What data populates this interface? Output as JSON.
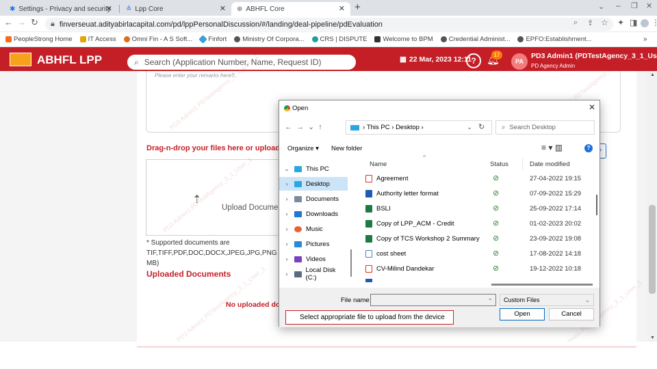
{
  "browser": {
    "tabs": [
      {
        "label": "Settings - Privacy and security",
        "active": false
      },
      {
        "label": "Lpp Core",
        "active": false
      },
      {
        "label": "ABHFL Core",
        "active": true
      }
    ],
    "new_tab": "+",
    "url": "finverseuat.adityabirlacapital.com/pd/lppPersonalDiscussion/#/landing/deal-pipeline/pdEvaluation",
    "bookmarks": [
      {
        "label": "PeopleStrong Home",
        "color": "#f36b21"
      },
      {
        "label": "IT Access",
        "color": "#e5a50a"
      },
      {
        "label": "Omni Fin - A S Soft...",
        "color": "#e06b1c"
      },
      {
        "label": "Finfort",
        "color": "#3aa0d8"
      },
      {
        "label": "Ministry Of Corpora...",
        "color": "#555555"
      },
      {
        "label": "CRS | DISPUTE",
        "color": "#1aa29b"
      },
      {
        "label": "Welcome to BPM",
        "color": "#333333"
      },
      {
        "label": "Credential Administ...",
        "color": "#555555"
      },
      {
        "label": "EPFO:Establishment...",
        "color": "#555555"
      }
    ],
    "more_bookmarks": "»"
  },
  "app": {
    "title": "ABHFL LPP",
    "search_placeholder": "Search (Application Number, Name, Request ID)",
    "date": "22 Mar, 2023 12:11",
    "notification_count": "17",
    "avatar_initials": "PA",
    "user_name": "PD3 Admin1 (PDTestAgency_3_1_User_",
    "user_role": "PD Agency Admin",
    "brand_color": "#c41f27"
  },
  "page": {
    "remarks_placeholder": "Please enter your remarks here?.",
    "drag_text": "Drag-n-drop your files here or upload by",
    "upload_label": "Upload Documer",
    "supported_docs": "* Supported documents are TIF,TIFF,PDF,DOC,DOCX,JPEG,JPG,PNG 5 MB)",
    "uploaded_heading": "Uploaded Documents",
    "no_docs": "No uploaded doc",
    "watermark": "PD3 Admin1 PDTestAgency_3_1_User_1"
  },
  "dialog": {
    "title": "Open",
    "path": [
      "This PC",
      "Desktop"
    ],
    "search_placeholder": "Search Desktop",
    "organize": "Organize ▾",
    "new_folder": "New folder",
    "nav_items": [
      {
        "label": "This PC",
        "color": "#29a8e0",
        "chev": "⌄"
      },
      {
        "label": "Desktop",
        "color": "#29a8e0",
        "chev": "›",
        "selected": true
      },
      {
        "label": "Documents",
        "color": "#7a8aa0",
        "chev": "›"
      },
      {
        "label": "Downloads",
        "color": "#1f78d1",
        "chev": "›"
      },
      {
        "label": "Music",
        "color": "#e8623a",
        "chev": "›"
      },
      {
        "label": "Pictures",
        "color": "#2a8ad8",
        "chev": "›"
      },
      {
        "label": "Videos",
        "color": "#7b3fc2",
        "chev": "›"
      },
      {
        "label": "Local Disk (C:)",
        "color": "#5a6b80",
        "chev": "›"
      }
    ],
    "columns": {
      "name": "Name",
      "status": "Status",
      "date": "Date modified"
    },
    "files": [
      {
        "name": "Agreement",
        "type": "pdf",
        "color": "#d32f2f",
        "status": "⊘",
        "date": "27-04-2022 19:15"
      },
      {
        "name": "Authority letter format",
        "type": "word",
        "color": "#1e5bb5",
        "status": "⊘",
        "date": "07-09-2022 15:29"
      },
      {
        "name": "BSLI",
        "type": "excel",
        "color": "#1d7a45",
        "status": "⊘",
        "date": "25-09-2022 17:14"
      },
      {
        "name": "Copy of LPP_ACM - Credit",
        "type": "excel",
        "color": "#1d7a45",
        "status": "⊘",
        "date": "01-02-2023 20:02"
      },
      {
        "name": "Copy of TCS Workshop 2 Summary",
        "type": "excel",
        "color": "#1d7a45",
        "status": "⊘",
        "date": "23-09-2022 19:08"
      },
      {
        "name": "cost sheet",
        "type": "text",
        "color": "#4a7fc1",
        "status": "⊘",
        "date": "17-08-2022 14:18"
      },
      {
        "name": "CV-Milind Dandekar",
        "type": "pdf",
        "color": "#d32f2f",
        "status": "⊘",
        "date": "19-12-2022 10:18"
      }
    ],
    "file_name_label": "File name:",
    "file_name_value": "",
    "file_type": "Custom Files",
    "open_label": "Open",
    "cancel_label": "Cancel"
  },
  "callout": "Select appropriate file to upload from the device"
}
